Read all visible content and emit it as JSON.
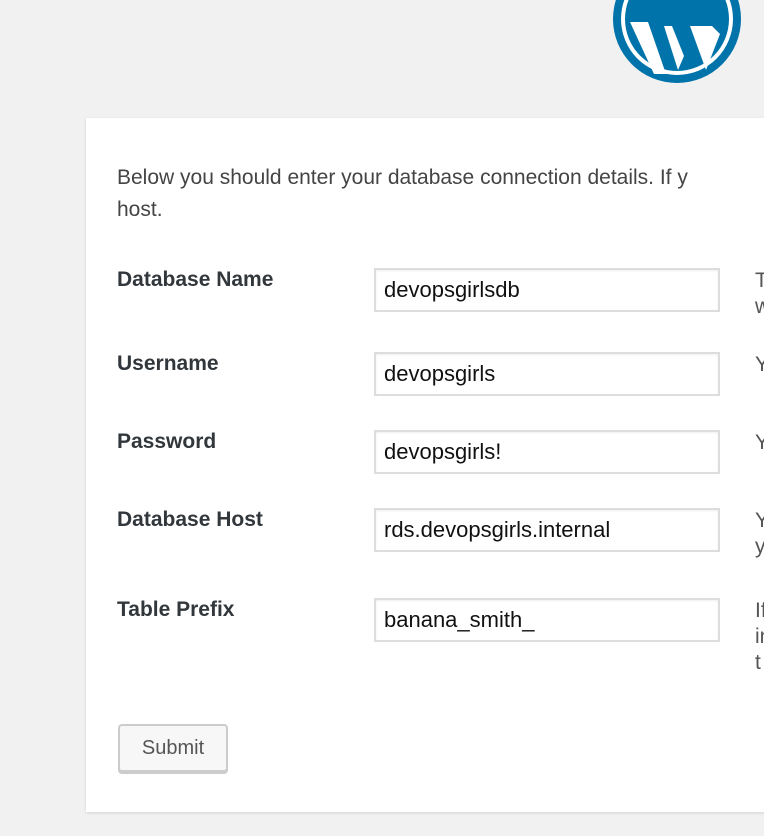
{
  "brand": {
    "logo": "wordpress-logo-icon",
    "color": "#0073aa"
  },
  "intro": {
    "line1": "Below you should enter your database connection details. If y",
    "line2": "host."
  },
  "form": {
    "rows": [
      {
        "label": "Database Name",
        "value": "devopsgirlsdb",
        "desc1": "T",
        "desc2": "w"
      },
      {
        "label": "Username",
        "value": "devopsgirls",
        "desc1": "Y"
      },
      {
        "label": "Password",
        "value": "devopsgirls!",
        "desc1": "Y"
      },
      {
        "label": "Database Host",
        "value": "rds.devopsgirls.internal",
        "desc1": "Y",
        "desc2": "y"
      },
      {
        "label": "Table Prefix",
        "value": "banana_smith_",
        "desc1": "If",
        "desc2": "in",
        "desc3": "t"
      }
    ],
    "submit_label": "Submit"
  }
}
